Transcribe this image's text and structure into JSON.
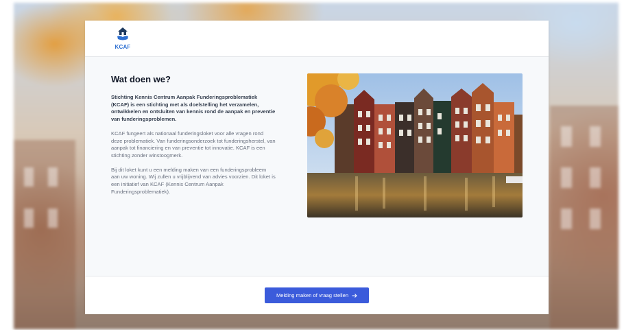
{
  "brand": {
    "logo_text": "KCAF",
    "logo_icon": "house-hands-icon"
  },
  "main": {
    "title": "Wat doen we?",
    "intro": "Stichting Kennis Centrum Aanpak Funderingsproblematiek (KCAF) is een stichting met als doelstelling het verzamelen, ontwikkelen en ontsluiten van kennis rond de aanpak en preventie van funderingsproblemen.",
    "paragraph2": "KCAF fungeert als nationaal funderingsloket voor alle vragen rond deze problematiek. Van funderingsonderzoek tot funderingsherstel, van aanpak tot financiering en van preventie tot innovatie. KCAF is een stichting zonder winstoogmerk.",
    "paragraph3": "Bij dit loket kunt u een melding maken van een funderingsprobleem aan uw woning. Wij zullen u vrijblijvend van advies voorzien. Dit loket is een initiatief van KCAF (Kennis Centrum Aanpak Funderingsproblematiek)."
  },
  "footer": {
    "cta_label": "Melding maken of vraag stellen",
    "cta_icon": "arrow-right-icon"
  },
  "colors": {
    "accent": "#3b5bdb",
    "logo": "#2d6fd1"
  }
}
